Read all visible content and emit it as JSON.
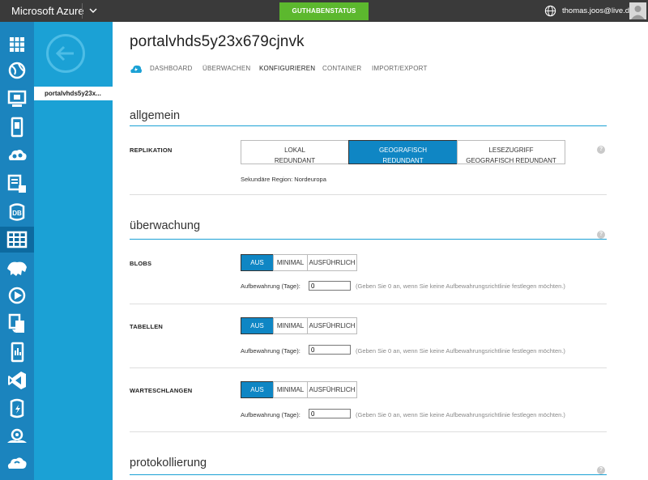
{
  "topbar": {
    "brand": "Microsoft Azure",
    "credit_button": "GUTHABENSTATUS",
    "user_email": "thomas.joos@live.de"
  },
  "sidebar": {
    "items": [
      {
        "icon": "all-items-icon"
      },
      {
        "icon": "web-sites-icon"
      },
      {
        "icon": "virtual-machines-icon"
      },
      {
        "icon": "mobile-services-icon"
      },
      {
        "icon": "cloud-services-icon"
      },
      {
        "icon": "batch-services-icon"
      },
      {
        "icon": "sql-databases-icon"
      },
      {
        "icon": "storage-icon",
        "active": true
      },
      {
        "icon": "hdinsight-icon"
      },
      {
        "icon": "media-services-icon"
      },
      {
        "icon": "service-bus-icon"
      },
      {
        "icon": "mobile-engagement-icon"
      },
      {
        "icon": "visual-studio-online-icon"
      },
      {
        "icon": "cache-icon"
      },
      {
        "icon": "biztalk-services-icon"
      },
      {
        "icon": "recovery-services-icon"
      }
    ]
  },
  "subpanel": {
    "resource_label": "portalvhds5y23x..."
  },
  "page": {
    "title": "portalvhds5y23x679cjnvk",
    "tabs": [
      {
        "label": "DASHBOARD"
      },
      {
        "label": "ÜBERWACHEN"
      },
      {
        "label": "KONFIGURIEREN",
        "active": true
      },
      {
        "label": "CONTAINER"
      },
      {
        "label": "IMPORT/EXPORT"
      }
    ]
  },
  "general": {
    "title": "allgemein",
    "replication": {
      "label": "REPLIKATION",
      "options": [
        {
          "line1": "LOKAL",
          "line2": "REDUNDANT"
        },
        {
          "line1": "GEOGRAFISCH",
          "line2": "REDUNDANT",
          "selected": true
        },
        {
          "line1": "LESEZUGRIFF",
          "line2": "GEOGRAFISCH REDUNDANT"
        }
      ],
      "secondary_region": "Sekundäre Region: Nordeuropa"
    }
  },
  "monitoring": {
    "title": "überwachung",
    "options": [
      "AUS",
      "MINIMAL",
      "AUSFÜHRLICH"
    ],
    "retention_label": "Aufbewahrung (Tage):",
    "retention_note": "(Geben Sie 0 an, wenn Sie keine Aufbewahrungsrichtlinie festlegen möchten.)",
    "rows": [
      {
        "label": "BLOBS",
        "selected": "AUS",
        "retention_value": "0"
      },
      {
        "label": "TABELLEN",
        "selected": "AUS",
        "retention_value": "0"
      },
      {
        "label": "WARTESCHLANGEN",
        "selected": "AUS",
        "retention_value": "0"
      }
    ]
  },
  "logging": {
    "title": "protokollierung"
  },
  "help_glyph": "?",
  "colors": {
    "topbar": "#3a3a3a",
    "accent_green": "#5cb82e",
    "iconbar": "#1b84be",
    "subpanel": "#1ba1d5",
    "selected": "#0f86c4"
  }
}
